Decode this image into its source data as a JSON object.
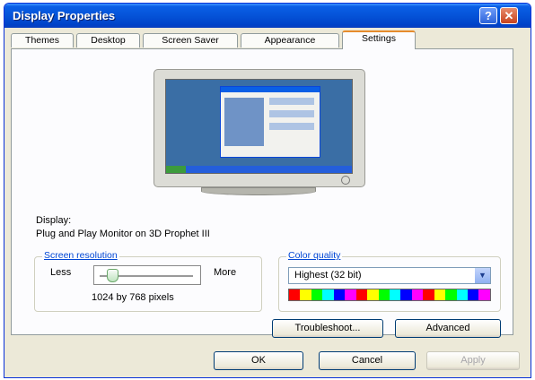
{
  "window": {
    "title": "Display Properties",
    "help_label": "?",
    "close_label": "✕"
  },
  "tabs": [
    {
      "label": "Themes"
    },
    {
      "label": "Desktop"
    },
    {
      "label": "Screen Saver"
    },
    {
      "label": "Appearance"
    },
    {
      "label": "Settings",
      "active": true
    }
  ],
  "display": {
    "label": "Display:",
    "value": "Plug and Play Monitor on 3D Prophet III"
  },
  "resolution": {
    "legend": "Screen resolution",
    "less_label": "Less",
    "more_label": "More",
    "value_text": "1024 by 768 pixels",
    "slider_position": 0.1
  },
  "color": {
    "legend": "Color quality",
    "selected": "Highest (32 bit)",
    "palette": [
      "#ff0000",
      "#ffff00",
      "#00ff00",
      "#00ffff",
      "#0000ff",
      "#ff00ff",
      "#ff0000",
      "#ffff00",
      "#00ff00",
      "#00ffff",
      "#0000ff",
      "#ff00ff",
      "#ff0000",
      "#ffff00",
      "#00ff00",
      "#00ffff",
      "#0000ff",
      "#ff00ff"
    ]
  },
  "buttons": {
    "troubleshoot": "Troubleshoot...",
    "advanced": "Advanced",
    "ok": "OK",
    "cancel": "Cancel",
    "apply": "Apply"
  },
  "colors": {
    "titlebar": "#0553d8",
    "accent_tab": "#e68b2c",
    "legend_text": "#0046d5"
  }
}
